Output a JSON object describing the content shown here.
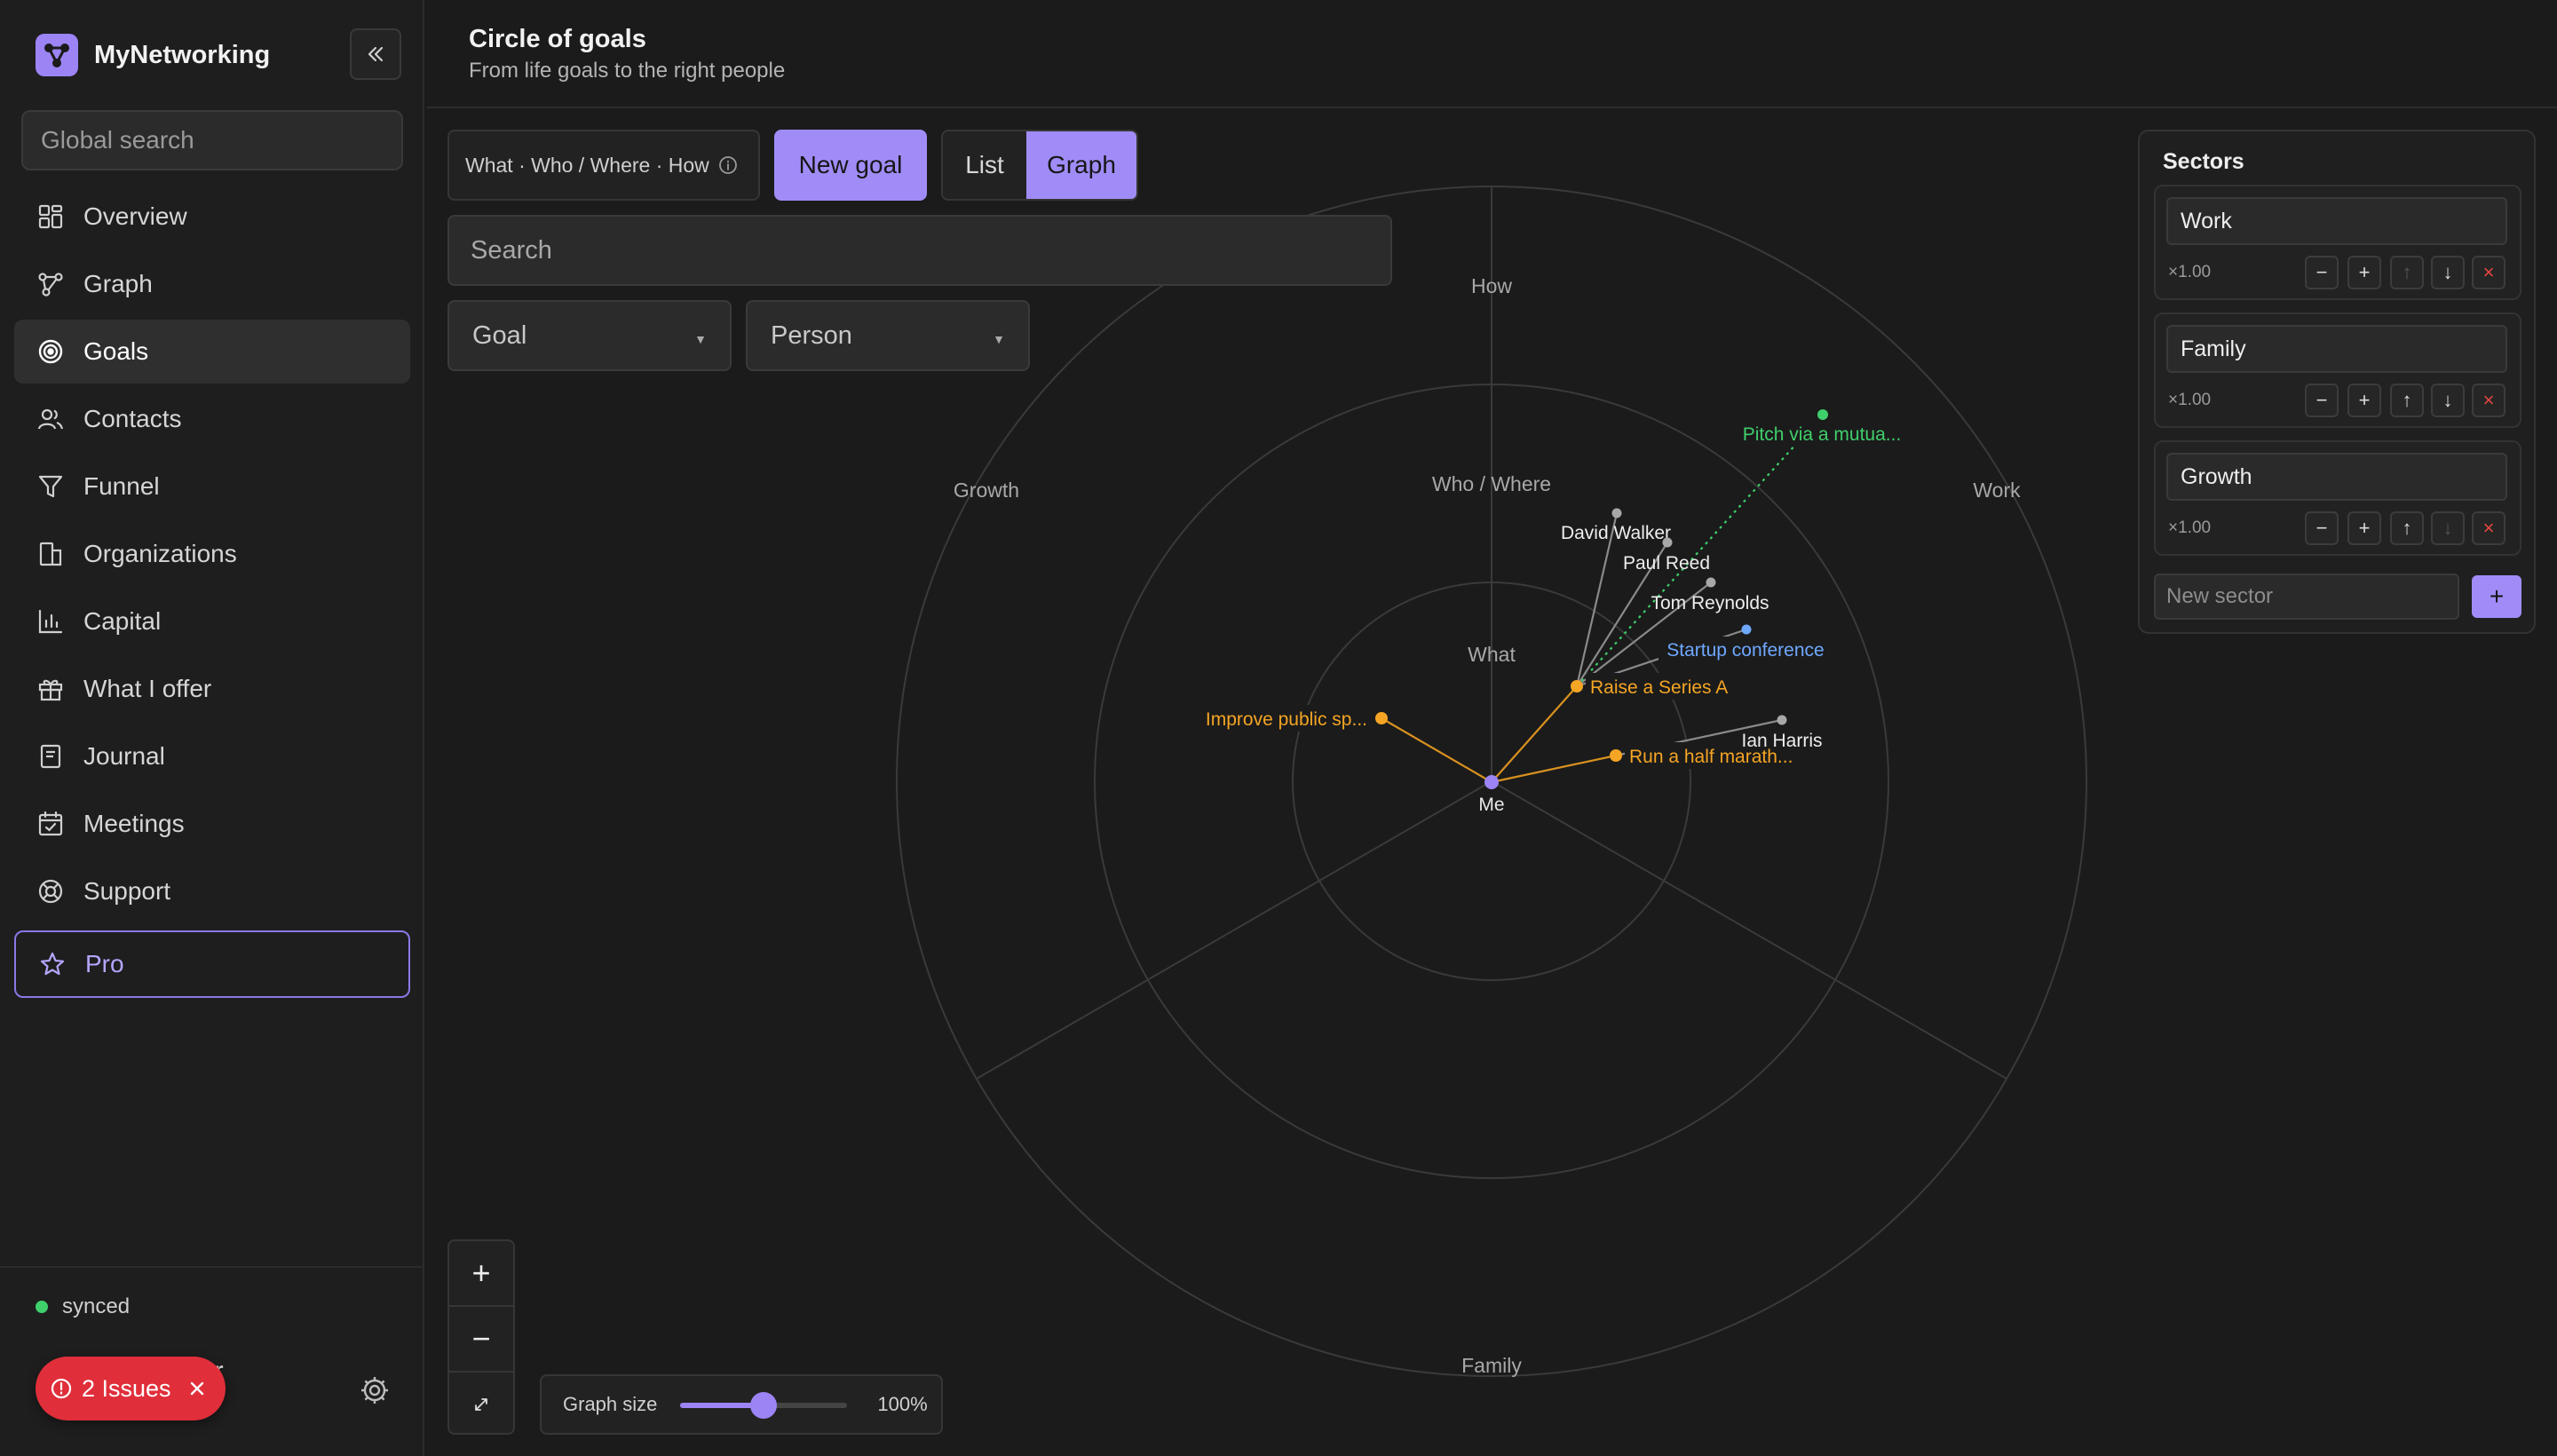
{
  "app": {
    "name": "MyNetworking",
    "global_search_placeholder": "Global search"
  },
  "sidebar": {
    "items": [
      {
        "label": "Overview",
        "icon": "grid-icon"
      },
      {
        "label": "Graph",
        "icon": "graph-icon"
      },
      {
        "label": "Goals",
        "icon": "target-icon",
        "active": true
      },
      {
        "label": "Contacts",
        "icon": "users-icon"
      },
      {
        "label": "Funnel",
        "icon": "funnel-icon"
      },
      {
        "label": "Organizations",
        "icon": "building-icon"
      },
      {
        "label": "Capital",
        "icon": "bar-chart-icon"
      },
      {
        "label": "What I offer",
        "icon": "gift-icon"
      },
      {
        "label": "Journal",
        "icon": "notebook-icon"
      },
      {
        "label": "Meetings",
        "icon": "calendar-icon"
      },
      {
        "label": "Support",
        "icon": "lifebuoy-icon"
      }
    ],
    "pro_label": "Pro",
    "sync_status": "synced",
    "user_name_partial": "ser",
    "issues_label": "2 Issues"
  },
  "header": {
    "title": "Circle of goals",
    "subtitle": "From life goals to the right people"
  },
  "toolbar": {
    "chip_label": "What · Who / Where · How",
    "new_goal": "New goal",
    "view_list": "List",
    "view_graph": "Graph",
    "search_placeholder": "Search",
    "goal_filter": "Goal",
    "person_filter": "Person"
  },
  "graph": {
    "ring_labels": {
      "how": "How",
      "who_where": "Who / Where",
      "what": "What"
    },
    "sector_labels": {
      "growth": "Growth",
      "work": "Work",
      "family": "Family"
    },
    "center_label": "Me",
    "goals": [
      {
        "label": "Raise a Series A",
        "color": "#f5a524"
      },
      {
        "label": "Improve public sp...",
        "color": "#f5a524"
      },
      {
        "label": "Run a half marath...",
        "color": "#f5a524"
      }
    ],
    "people": [
      {
        "label": "David Walker"
      },
      {
        "label": "Paul Reed"
      },
      {
        "label": "Tom Reynolds"
      },
      {
        "label": "Ian Harris"
      }
    ],
    "places": [
      {
        "label": "Startup conference",
        "color": "#6ea8ff"
      }
    ],
    "hows": [
      {
        "label": "Pitch via a mutua...",
        "color": "#3fcf6b"
      }
    ]
  },
  "sectors": {
    "title": "Sectors",
    "items": [
      {
        "name": "Work",
        "multiplier": "×1.00"
      },
      {
        "name": "Family",
        "multiplier": "×1.00"
      },
      {
        "name": "Growth",
        "multiplier": "×1.00"
      }
    ],
    "new_placeholder": "New sector"
  },
  "controls": {
    "graph_size_label": "Graph size",
    "graph_size_value": "100%",
    "graph_size_fraction": 0.5
  },
  "colors": {
    "accent": "#a18cf7",
    "goal": "#f5a524",
    "place": "#6ea8ff",
    "how": "#3fcf6b",
    "danger": "#e02f3a"
  }
}
